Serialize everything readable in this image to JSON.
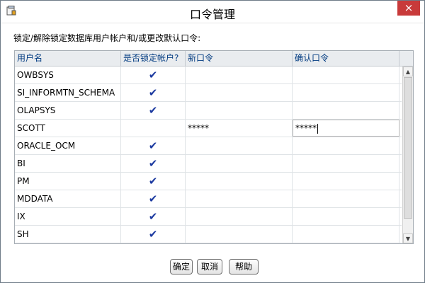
{
  "window": {
    "title": "口令管理",
    "close_label": "×"
  },
  "subtitle": "锁定/解除锁定数据库用户帐户和/或更改默认口令:",
  "table": {
    "columns": [
      "用户名",
      "是否锁定帐户?",
      "新口令",
      "确认口令"
    ],
    "rows": [
      {
        "user": "OWBSYS",
        "locked": "✔",
        "new_password": "",
        "confirm_password": ""
      },
      {
        "user": "SI_INFORMTN_SCHEMA",
        "locked": "✔",
        "new_password": "",
        "confirm_password": ""
      },
      {
        "user": "OLAPSYS",
        "locked": "✔",
        "new_password": "",
        "confirm_password": ""
      },
      {
        "user": "SCOTT",
        "locked": "",
        "new_password": "*****",
        "confirm_password": "*****"
      },
      {
        "user": "ORACLE_OCM",
        "locked": "✔",
        "new_password": "",
        "confirm_password": ""
      },
      {
        "user": "BI",
        "locked": "✔",
        "new_password": "",
        "confirm_password": ""
      },
      {
        "user": "PM",
        "locked": "✔",
        "new_password": "",
        "confirm_password": ""
      },
      {
        "user": "MDDATA",
        "locked": "✔",
        "new_password": "",
        "confirm_password": ""
      },
      {
        "user": "IX",
        "locked": "✔",
        "new_password": "",
        "confirm_password": ""
      },
      {
        "user": "SH",
        "locked": "✔",
        "new_password": "",
        "confirm_password": ""
      }
    ]
  },
  "buttons": {
    "ok": "确定",
    "cancel": "取消",
    "help": "帮助"
  },
  "colors": {
    "header_text": "#003a80",
    "check": "#1c3aa0",
    "close": "#c83a3a"
  }
}
